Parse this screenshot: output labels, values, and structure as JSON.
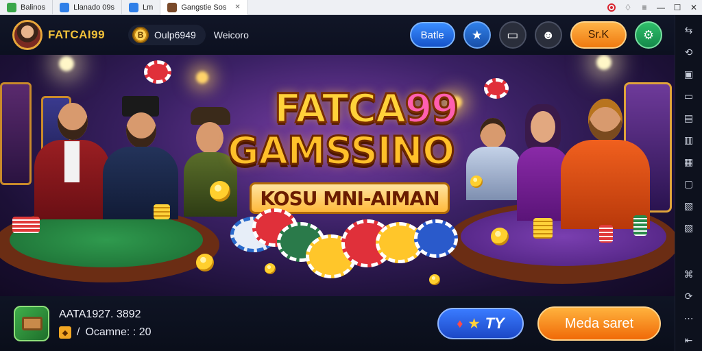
{
  "os_tabs": [
    {
      "label": "Balinos",
      "icon": "app-icon",
      "color": "#3aa64a"
    },
    {
      "label": "Llanado 09s",
      "icon": "window-icon",
      "color": "#2f7fe8"
    },
    {
      "label": "Lm",
      "icon": "window-icon",
      "color": "#2f7fe8"
    },
    {
      "label": "Gangstie Sos",
      "icon": "game-tab-icon",
      "color": "#7a4a2a"
    }
  ],
  "hud": {
    "brand": "FATCAI99",
    "coins": "Oulp6949",
    "welcome": "Weicoro",
    "battle_label": "Batle",
    "sk_label": "Sr.K",
    "coin_symbol": "B"
  },
  "banner": {
    "title_line1_part1": "FATCA",
    "title_line1_part2": "99",
    "title_line2": "GAMSSINO",
    "subtitle": "KOSU MNI-AIMAN"
  },
  "bottom": {
    "game_name": "AATA1927. 3892",
    "meta_sep": "/",
    "meta_text": "Ocamne: : 20",
    "ty_label": "TY",
    "start_label": "Meda saret"
  },
  "colors": {
    "accent_orange": "#f06a08",
    "accent_blue": "#1c48c6",
    "brand_gold": "#f3c23a"
  }
}
